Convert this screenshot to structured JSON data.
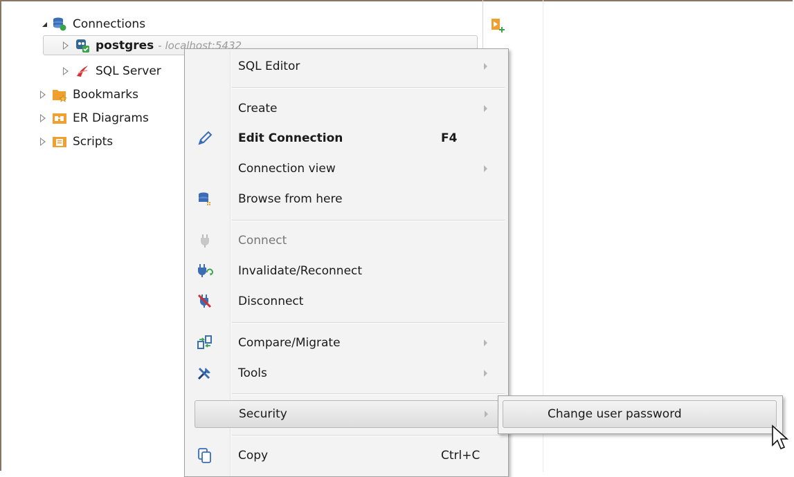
{
  "tree": {
    "connections_label": "Connections",
    "postgres_label": "postgres",
    "postgres_detail": "- localhost:5432",
    "sqlserver_label": "SQL Server",
    "bookmarks_label": "Bookmarks",
    "er_diagrams_label": "ER Diagrams",
    "scripts_label": "Scripts"
  },
  "context_menu": {
    "sql_editor": "SQL Editor",
    "create": "Create",
    "edit_connection": "Edit Connection",
    "edit_connection_shortcut": "F4",
    "connection_view": "Connection view",
    "browse_from_here": "Browse from here",
    "connect": "Connect",
    "invalidate_reconnect": "Invalidate/Reconnect",
    "disconnect": "Disconnect",
    "compare_migrate": "Compare/Migrate",
    "tools": "Tools",
    "security": "Security",
    "copy": "Copy",
    "copy_shortcut": "Ctrl+C"
  },
  "security_submenu": {
    "change_user_password": "Change user password"
  },
  "colors": {
    "folder_orange": "#f0a030",
    "db_blue": "#3b6db5",
    "accent_green": "#3aa34a",
    "disconnect_red": "#d23030"
  }
}
